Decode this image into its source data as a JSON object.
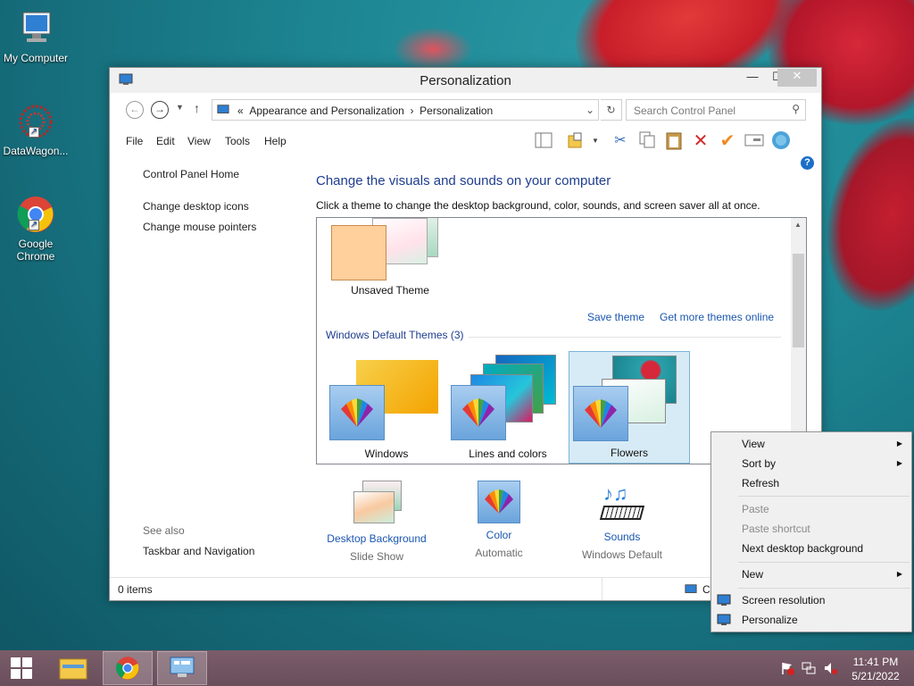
{
  "desktop": {
    "icons": [
      {
        "label": "My Computer"
      },
      {
        "label": "DataWagon..."
      },
      {
        "label": "Google Chrome"
      }
    ]
  },
  "window": {
    "title": "Personalization",
    "address": {
      "prefix": "«",
      "crumb1": "Appearance and Personalization",
      "sep": "›",
      "crumb2": "Personalization"
    },
    "search_placeholder": "Search Control Panel",
    "menu": [
      "File",
      "Edit",
      "View",
      "Tools",
      "Help"
    ],
    "left_pane": {
      "home": "Control Panel Home",
      "link1": "Change desktop icons",
      "link2": "Change mouse pointers",
      "see_also": "See also",
      "taskbar": "Taskbar and Navigation"
    },
    "heading": "Change the visuals and sounds on your computer",
    "subheading": "Click a theme to change the desktop background, color, sounds, and screen saver all at once.",
    "my_themes": {
      "unsaved_label": "Unsaved Theme",
      "save_theme": "Save theme",
      "get_more": "Get more themes online"
    },
    "default_group": "Windows Default Themes (3)",
    "themes": [
      {
        "label": "Windows"
      },
      {
        "label": "Lines and colors"
      },
      {
        "label": "Flowers"
      }
    ],
    "bottom": {
      "background": {
        "title": "Desktop Background",
        "value": "Slide Show"
      },
      "color": {
        "title": "Color",
        "value": "Automatic"
      },
      "sounds": {
        "title": "Sounds",
        "value": "Windows Default"
      }
    },
    "status": {
      "items": "0 items",
      "right": "C"
    }
  },
  "context_menu": {
    "view": "View",
    "sort_by": "Sort by",
    "refresh": "Refresh",
    "paste": "Paste",
    "paste_shortcut": "Paste shortcut",
    "next_bg": "Next desktop background",
    "new": "New",
    "screen_res": "Screen resolution",
    "personalize": "Personalize"
  },
  "taskbar": {
    "time": "11:41 PM",
    "date": "5/21/2022"
  },
  "colors": {
    "accent_link": "#1a56b0",
    "heading": "#1e3d8f",
    "taskbar": "#6e5260",
    "selection": "#d7ebf6"
  }
}
